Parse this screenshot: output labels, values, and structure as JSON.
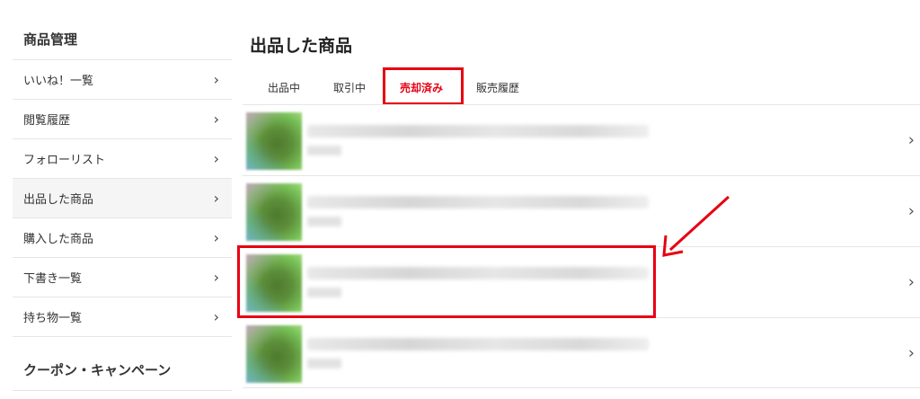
{
  "sidebar": {
    "section1_title": "商品管理",
    "items": [
      {
        "label": "いいね！一覧",
        "chevron": "›"
      },
      {
        "label": "閲覧履歴",
        "chevron": "›"
      },
      {
        "label": "フォローリスト",
        "chevron": "›"
      },
      {
        "label": "出品した商品",
        "chevron": "›"
      },
      {
        "label": "購入した商品",
        "chevron": "›"
      },
      {
        "label": "下書き一覧",
        "chevron": "›"
      },
      {
        "label": "持ち物一覧",
        "chevron": "›"
      }
    ],
    "section2_title": "クーポン・キャンペーン",
    "active_item": "出品した商品"
  },
  "main": {
    "title": "出品した商品",
    "tabs": [
      {
        "label": "出品中"
      },
      {
        "label": "取引中"
      },
      {
        "label": "売却済み"
      },
      {
        "label": "販売履歴"
      }
    ],
    "active_tab": "売却済み",
    "rows": [
      {
        "chevron": "›"
      },
      {
        "chevron": "›"
      },
      {
        "chevron": "›"
      },
      {
        "chevron": "›"
      }
    ]
  },
  "colors": {
    "accent": "#e60012",
    "divider": "#e6e6e6",
    "active_bg": "#f5f5f5"
  },
  "icons": [
    "chevron-right-icon",
    "annotation-arrow-icon"
  ]
}
